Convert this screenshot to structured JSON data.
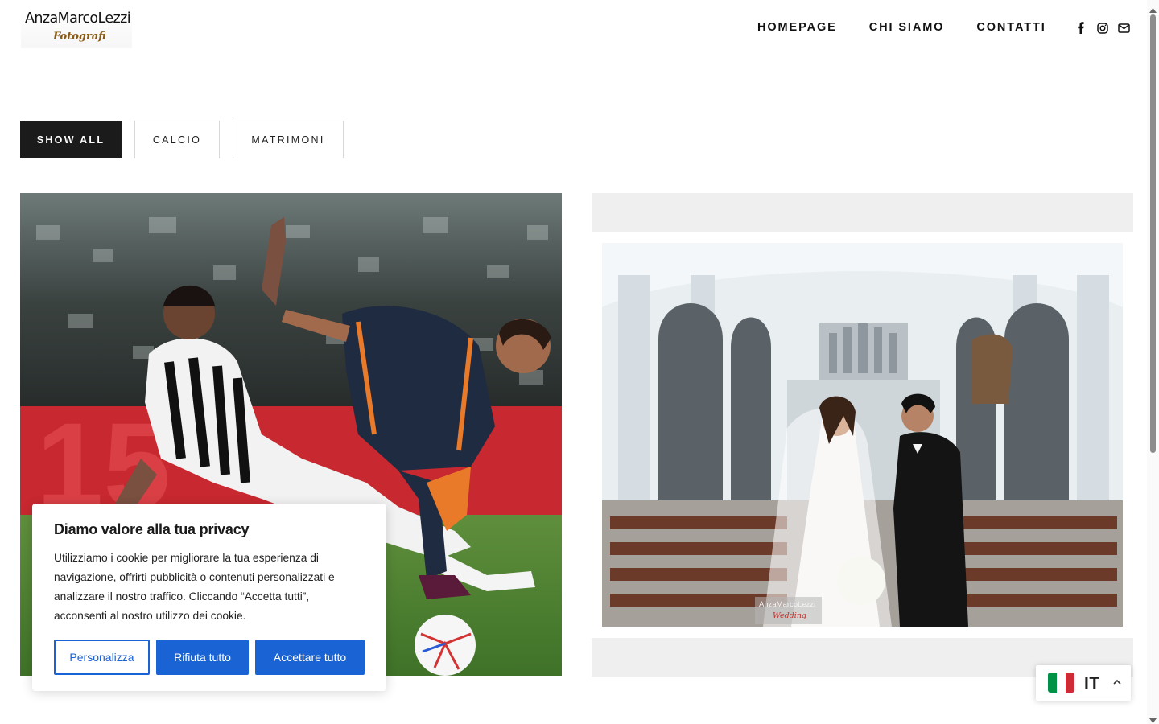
{
  "header": {
    "logo_main": "AnzaMarcoLezzi",
    "logo_sub": "Fotografi",
    "nav": [
      "HOMEPAGE",
      "CHI SIAMO",
      "CONTATTI"
    ],
    "social_icons": [
      "facebook-icon",
      "instagram-icon",
      "email-icon"
    ]
  },
  "filters": {
    "items": [
      "SHOW ALL",
      "CALCIO",
      "MATRIMONI"
    ],
    "active": "SHOW ALL"
  },
  "gallery": {
    "watermark_line1": "AnzaMarcoLezzi",
    "watermark_line2": "Wedding"
  },
  "cookie": {
    "title": "Diamo valore alla tua privacy",
    "text": "Utilizziamo i cookie per migliorare la tua esperienza di navigazione, offrirti pubblicità o contenuti personalizzati e analizzare il nostro traffico. Cliccando “Accetta tutti”, acconsenti al nostro utilizzo dei cookie.",
    "customize_label": "Personalizza",
    "reject_label": "Rifiuta tutto",
    "accept_label": "Accettare tutto"
  },
  "language": {
    "code": "IT",
    "flag_colors": [
      "#009246",
      "#ffffff",
      "#ce2b37"
    ]
  },
  "colors": {
    "primary_blue": "#1a63d4",
    "active_filter_bg": "#1b1b1b"
  }
}
